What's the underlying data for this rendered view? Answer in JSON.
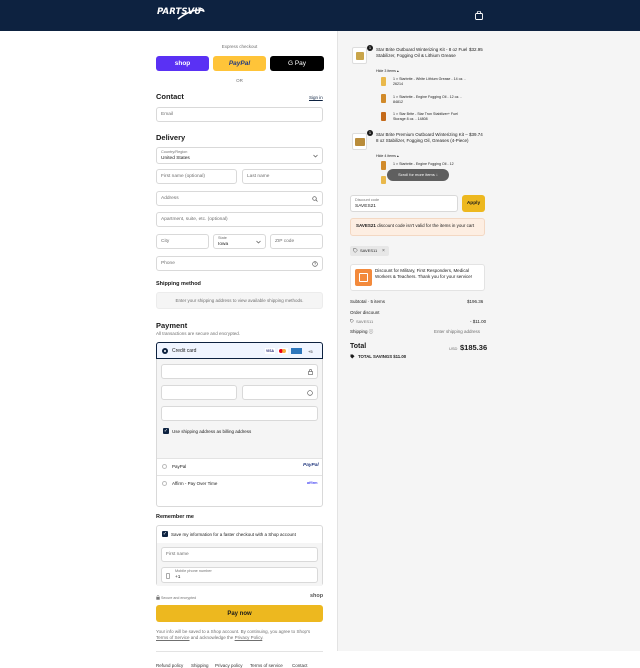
{
  "brand": {
    "logo_text": "PARTSVU",
    "header_color": "#0d2240"
  },
  "express": {
    "title": "Express checkout",
    "shop": "shop",
    "paypal": "PayPal",
    "gpay": "G Pay",
    "or": "OR"
  },
  "contact": {
    "heading": "Contact",
    "signin": "Sign in",
    "email_placeholder": "Email"
  },
  "delivery": {
    "heading": "Delivery",
    "country_label": "Country/Region",
    "country_value": "United States",
    "first_name": "First name (optional)",
    "last_name": "Last name",
    "address": "Address",
    "apartment": "Apartment, suite, etc. (optional)",
    "city": "City",
    "state_label": "State",
    "state_value": "Iowa",
    "zip": "ZIP code",
    "phone": "Phone"
  },
  "shipping": {
    "heading": "Shipping method",
    "note": "Enter your shipping address to view available shipping methods."
  },
  "payment": {
    "heading": "Payment",
    "note": "All transactions are secure and encrypted.",
    "credit_card": "Credit card",
    "card_more": "+5",
    "billing_same": "Use shipping address as billing address",
    "paypal": "PayPal",
    "affirm": "Affirm - Pay Over Time",
    "affirm_logo": "affirm"
  },
  "remember": {
    "heading": "Remember me",
    "save_label": "Save my information for a faster checkout with a Shop account",
    "first_name": "First name",
    "mobile_label": "Mobile phone number",
    "mobile_value": "+1",
    "secure": "Secure and encrypted",
    "shop_logo": "shop"
  },
  "pay_now": "Pay now",
  "legal": {
    "text1": "Your info will be saved to a Shop account. By continuing, you agree to",
    "text2": "Shop's",
    "terms": "Terms of Service",
    "text3": "and acknowledge the",
    "privacy": "Privacy Policy",
    "text4": "."
  },
  "footer_links": [
    "Refund policy",
    "Shipping",
    "Privacy policy",
    "Terms of service",
    "Contact"
  ],
  "cart": {
    "items": [
      {
        "qty": "1",
        "title": "Star Brite Outboard Winterizing Kit - 8 oz Fuel Stabilizer, Fogging Oil & Lithium Grease",
        "price": "$32.95",
        "toggle": "Hide 3 items",
        "subs": [
          "1 × Starbrite - White Lithium Grease - 14 oz. - 26214",
          "1 × Starbrite - Engine Fogging Oil - 12 oz. - 84812",
          "1 × Star Brite - Star Tron Stabilizer+ Fuel Storage 8 oz. - 14808"
        ]
      },
      {
        "qty": "1",
        "title": "Star Brite Premium Outboard Winterizing Kit – 8 oz Stabilizer, Fogging Oil, Greases (4-Piece)",
        "price": "$39.74",
        "toggle": "Hide 4 items",
        "subs": [
          "1 × Starbrite - Engine Fogging Oil - 12",
          "1 × Starbrite - ..."
        ]
      }
    ],
    "scroll_hint": "Scroll for more items",
    "discount_label": "Discount code",
    "discount_value": "SAVES21",
    "apply": "Apply",
    "error_code": "SAVES21",
    "error_text": "discount code isn't valid for the items in your cart",
    "tag": "SAVES11",
    "promo": "Discount for Military, First Responders, Medical Workers & Teachers. Thank you for your service!",
    "subtotal_label": "Subtotal · 5 items",
    "subtotal": "$196.36",
    "order_discount": "Order discount",
    "discount_code": "SAVES11",
    "discount_amount": "- $11.00",
    "shipping_label": "Shipping",
    "shipping_value": "Enter shipping address",
    "total_label": "Total",
    "currency": "USD",
    "total": "$185.36",
    "savings_label": "TOTAL SAVINGS",
    "savings": "$11.00"
  }
}
